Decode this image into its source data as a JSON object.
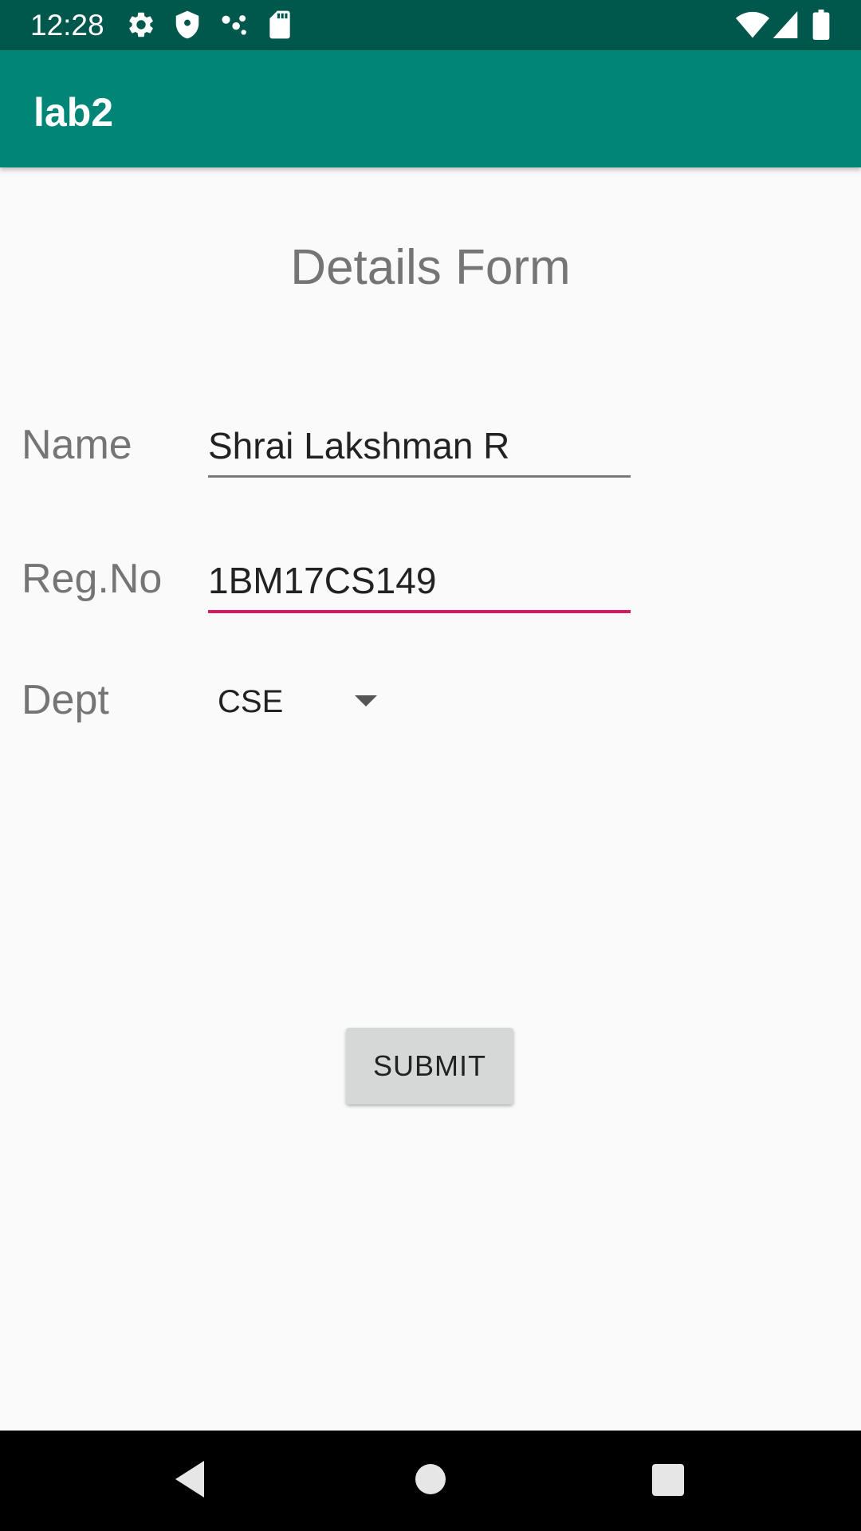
{
  "status_bar": {
    "time": "12:28",
    "left_icons": [
      "settings-icon",
      "shield-icon",
      "share-dots-icon",
      "sd-card-icon"
    ],
    "right_icons": [
      "wifi-icon",
      "signal-icon",
      "battery-icon"
    ]
  },
  "app_bar": {
    "title": "lab2",
    "color": "#008577"
  },
  "form": {
    "title": "Details Form",
    "name_label": "Name",
    "name_value": "Shrai Lakshman R",
    "regno_label": "Reg.No",
    "regno_value": "1BM17CS149",
    "dept_label": "Dept",
    "dept_value": "CSE",
    "submit_label": "SUBMIT",
    "accent_color": "#d81b60"
  },
  "nav_bar": {
    "buttons": [
      "back-icon",
      "home-icon",
      "recents-icon"
    ]
  }
}
